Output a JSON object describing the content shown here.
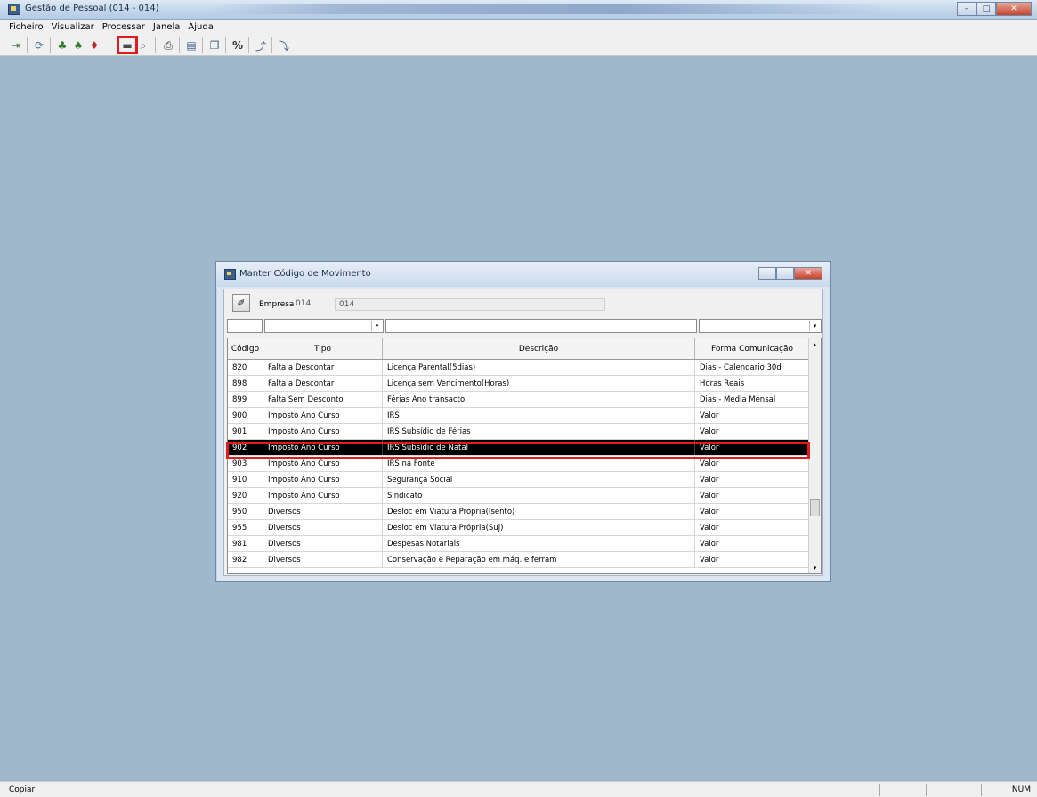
{
  "window": {
    "title": "Gestão de Pessoal (014 - 014)",
    "minimize": "–",
    "maximize": "□",
    "close": "✕"
  },
  "menu": {
    "items": [
      "Ficheiro",
      "Visualizar",
      "Processar",
      "Janela",
      "Ajuda"
    ]
  },
  "toolbar": {
    "buttons": [
      {
        "name": "exit-icon",
        "glyph": "⇥"
      },
      {
        "name": "refresh-icon",
        "glyph": "⟳"
      },
      {
        "name": "add-employee-icon",
        "glyph": "♣"
      },
      {
        "name": "edit-employee-icon",
        "glyph": "♠"
      },
      {
        "name": "delete-employee-icon",
        "glyph": "♦"
      },
      {
        "name": "movement-codes-icon",
        "glyph": "▬"
      },
      {
        "name": "search-icon",
        "glyph": "⌕"
      },
      {
        "name": "print-icon",
        "glyph": "⎙"
      },
      {
        "name": "report-icon",
        "glyph": "▤"
      },
      {
        "name": "window-icon",
        "glyph": "❐"
      },
      {
        "name": "percent-icon",
        "glyph": "%"
      },
      {
        "name": "export-icon",
        "glyph": "⤴"
      },
      {
        "name": "import-icon",
        "glyph": "⤵"
      }
    ]
  },
  "dialog": {
    "title": "Manter Código de Movimento",
    "minimize": "–",
    "maximize": "□",
    "close": "✕",
    "clear_button": "✐",
    "empresa_label": "Empresa",
    "empresa_code": "014",
    "empresa_name": "014",
    "filter_dropdown_arrow": "▾",
    "columns": [
      "Código",
      "Tipo",
      "Descrição",
      "Forma Comunicação"
    ],
    "rows": [
      {
        "codigo": "820",
        "tipo": "Falta a Descontar",
        "descricao": "Licença Parental(5dias)",
        "forma": "Dias - Calendario 30d"
      },
      {
        "codigo": "898",
        "tipo": "Falta a Descontar",
        "descricao": "Licença sem Vencimento(Horas)",
        "forma": "Horas Reais"
      },
      {
        "codigo": "899",
        "tipo": "Falta Sem Desconto",
        "descricao": "Férias Ano transacto",
        "forma": "Dias - Media Mensal"
      },
      {
        "codigo": "900",
        "tipo": "Imposto Ano Curso",
        "descricao": "IRS",
        "forma": "Valor"
      },
      {
        "codigo": "901",
        "tipo": "Imposto Ano Curso",
        "descricao": "IRS Subsídio de Férias",
        "forma": "Valor"
      },
      {
        "codigo": "902",
        "tipo": "Imposto Ano Curso",
        "descricao": "IRS Subsídio de Natal",
        "forma": "Valor"
      },
      {
        "codigo": "903",
        "tipo": "Imposto Ano Curso",
        "descricao": "IRS na Fonte",
        "forma": "Valor"
      },
      {
        "codigo": "910",
        "tipo": "Imposto Ano Curso",
        "descricao": "Segurança Social",
        "forma": "Valor"
      },
      {
        "codigo": "920",
        "tipo": "Imposto Ano Curso",
        "descricao": "Sindicato",
        "forma": "Valor"
      },
      {
        "codigo": "950",
        "tipo": "Diversos",
        "descricao": "Desloc em Viatura Própria(Isento)",
        "forma": "Valor"
      },
      {
        "codigo": "955",
        "tipo": "Diversos",
        "descricao": "Desloc em Viatura Própria(Suj)",
        "forma": "Valor"
      },
      {
        "codigo": "981",
        "tipo": "Diversos",
        "descricao": "Despesas Notariais",
        "forma": "Valor"
      },
      {
        "codigo": "982",
        "tipo": "Diversos",
        "descricao": "Conservação e Reparação em máq. e ferram",
        "forma": "Valor"
      }
    ],
    "selected_row_index": 5,
    "scroll_up": "▴",
    "scroll_down": "▾"
  },
  "status": {
    "message": "Copiar",
    "num": "NUM"
  }
}
